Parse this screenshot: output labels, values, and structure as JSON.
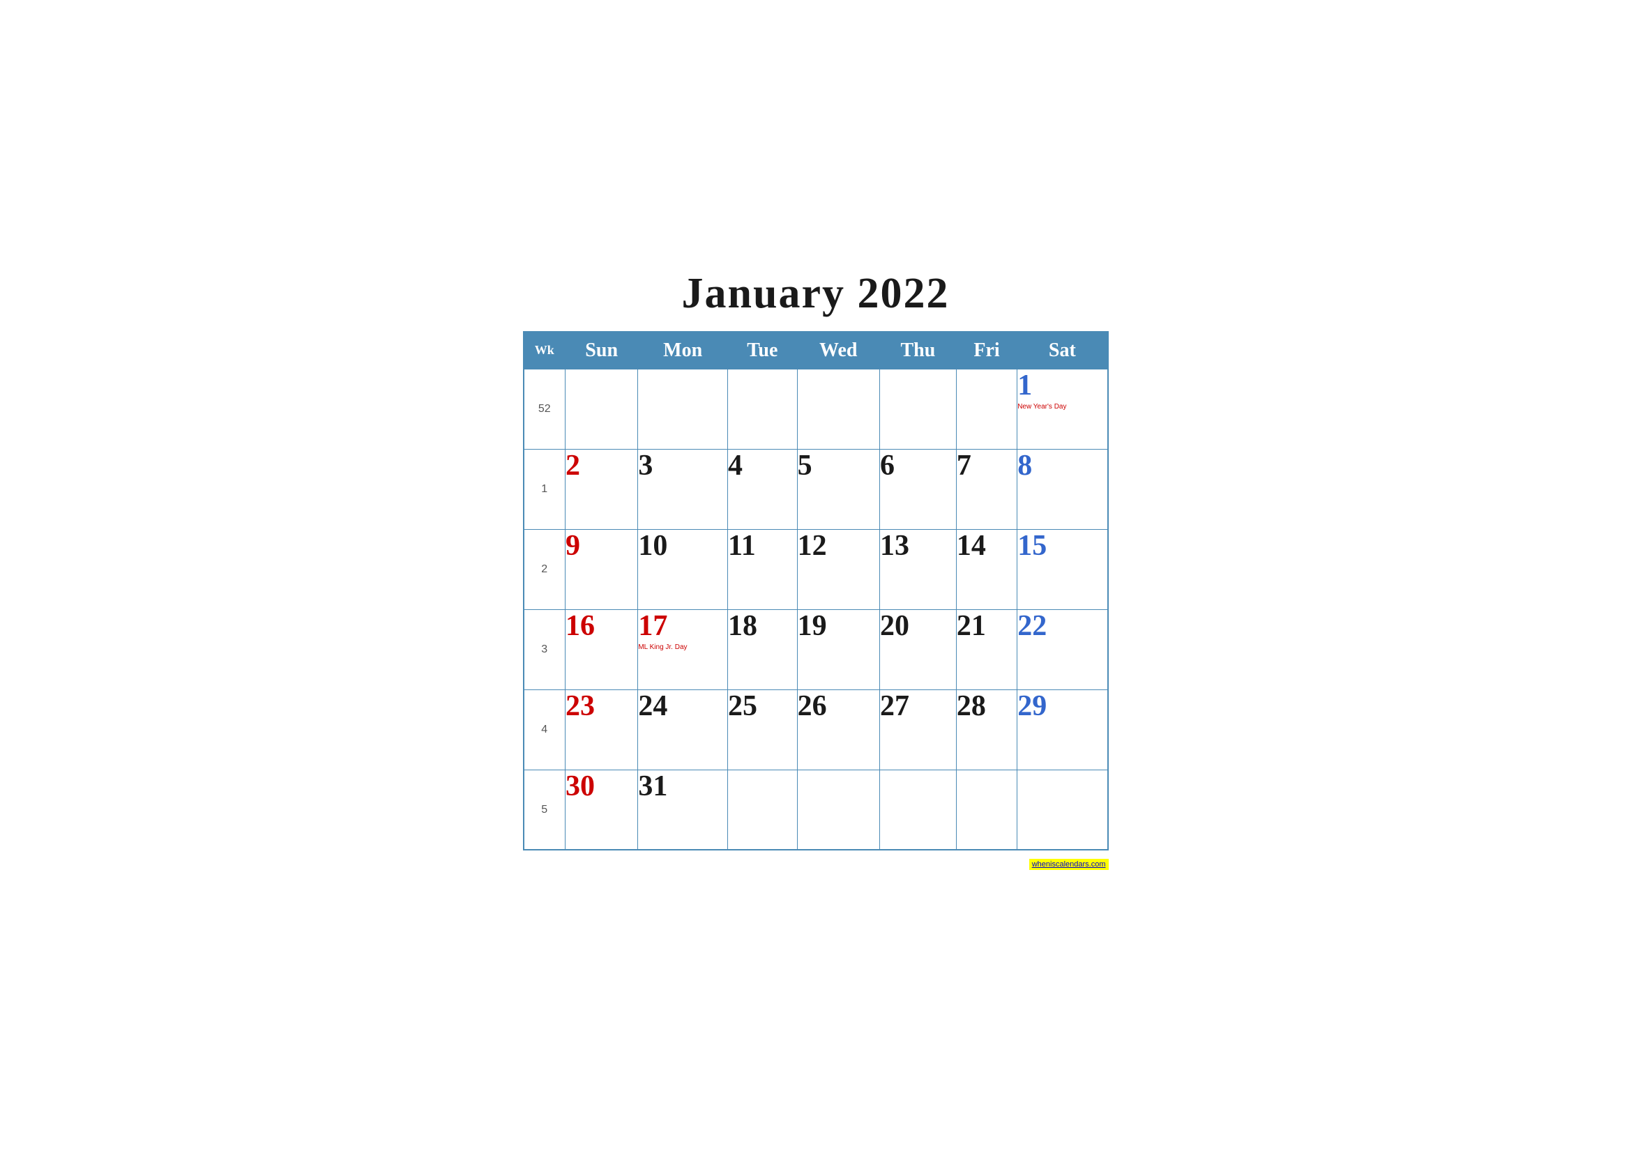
{
  "title": "January 2022",
  "header": {
    "wk_label": "Wk",
    "days": [
      "Sun",
      "Mon",
      "Tue",
      "Wed",
      "Thu",
      "Fri",
      "Sat"
    ]
  },
  "weeks": [
    {
      "week_num": "52",
      "days": [
        {
          "num": "",
          "type": "empty"
        },
        {
          "num": "",
          "type": "empty"
        },
        {
          "num": "",
          "type": "empty"
        },
        {
          "num": "",
          "type": "empty"
        },
        {
          "num": "",
          "type": "empty"
        },
        {
          "num": "",
          "type": "empty"
        },
        {
          "num": "1",
          "type": "saturday",
          "holiday": "New Year's Day",
          "holiday_color": "red"
        }
      ]
    },
    {
      "week_num": "1",
      "days": [
        {
          "num": "2",
          "type": "sunday"
        },
        {
          "num": "3",
          "type": "weekday"
        },
        {
          "num": "4",
          "type": "weekday"
        },
        {
          "num": "5",
          "type": "weekday"
        },
        {
          "num": "6",
          "type": "weekday"
        },
        {
          "num": "7",
          "type": "weekday"
        },
        {
          "num": "8",
          "type": "saturday"
        }
      ]
    },
    {
      "week_num": "2",
      "days": [
        {
          "num": "9",
          "type": "sunday"
        },
        {
          "num": "10",
          "type": "weekday"
        },
        {
          "num": "11",
          "type": "weekday"
        },
        {
          "num": "12",
          "type": "weekday"
        },
        {
          "num": "13",
          "type": "weekday"
        },
        {
          "num": "14",
          "type": "weekday"
        },
        {
          "num": "15",
          "type": "saturday"
        }
      ]
    },
    {
      "week_num": "3",
      "days": [
        {
          "num": "16",
          "type": "sunday"
        },
        {
          "num": "17",
          "type": "holiday-red",
          "holiday": "ML King Jr. Day",
          "holiday_color": "red"
        },
        {
          "num": "18",
          "type": "weekday"
        },
        {
          "num": "19",
          "type": "weekday"
        },
        {
          "num": "20",
          "type": "weekday"
        },
        {
          "num": "21",
          "type": "weekday"
        },
        {
          "num": "22",
          "type": "saturday"
        }
      ]
    },
    {
      "week_num": "4",
      "days": [
        {
          "num": "23",
          "type": "sunday"
        },
        {
          "num": "24",
          "type": "weekday"
        },
        {
          "num": "25",
          "type": "weekday"
        },
        {
          "num": "26",
          "type": "weekday"
        },
        {
          "num": "27",
          "type": "weekday"
        },
        {
          "num": "28",
          "type": "weekday"
        },
        {
          "num": "29",
          "type": "saturday"
        }
      ]
    },
    {
      "week_num": "5",
      "days": [
        {
          "num": "30",
          "type": "sunday"
        },
        {
          "num": "31",
          "type": "weekday"
        },
        {
          "num": "",
          "type": "empty"
        },
        {
          "num": "",
          "type": "empty"
        },
        {
          "num": "",
          "type": "empty"
        },
        {
          "num": "",
          "type": "empty"
        },
        {
          "num": "",
          "type": "empty"
        }
      ]
    }
  ],
  "watermark": {
    "text": "wheniscalendars.com",
    "url": "#"
  }
}
